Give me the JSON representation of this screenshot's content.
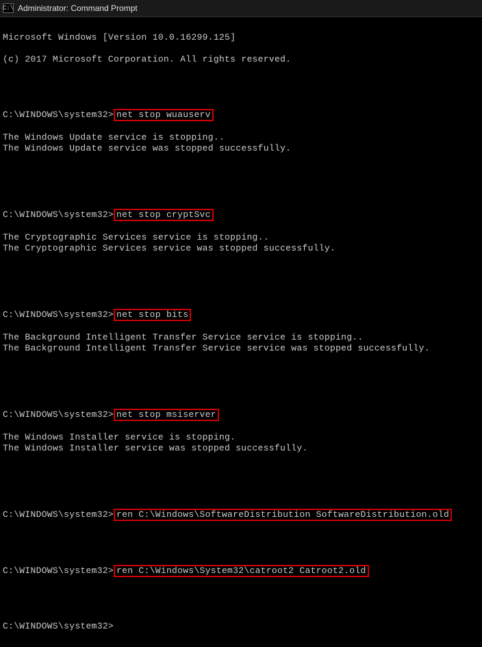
{
  "window": {
    "title": "Administrator: Command Prompt",
    "icon_label": "C:\\"
  },
  "banner": {
    "line1": "Microsoft Windows [Version 10.0.16299.125]",
    "line2": "(c) 2017 Microsoft Corporation. All rights reserved."
  },
  "prompt": "C:\\WINDOWS\\system32>",
  "blocks": [
    {
      "cmd": "net stop wuauserv",
      "out1": "The Windows Update service is stopping..",
      "out2": "The Windows Update service was stopped successfully."
    },
    {
      "cmd": "net stop cryptSvc",
      "out1": "The Cryptographic Services service is stopping..",
      "out2": "The Cryptographic Services service was stopped successfully."
    },
    {
      "cmd": "net stop bits",
      "out1": "The Background Intelligent Transfer Service service is stopping..",
      "out2": "The Background Intelligent Transfer Service service was stopped successfully."
    },
    {
      "cmd": "net stop msiserver",
      "out1": "The Windows Installer service is stopping.",
      "out2": "The Windows Installer service was stopped successfully."
    }
  ],
  "rename": [
    {
      "cmd": "ren C:\\Windows\\SoftwareDistribution SoftwareDistribution.old"
    },
    {
      "cmd": "ren C:\\Windows\\System32\\catroot2 Catroot2.old"
    }
  ],
  "final_prompt": "C:\\WINDOWS\\system32>"
}
